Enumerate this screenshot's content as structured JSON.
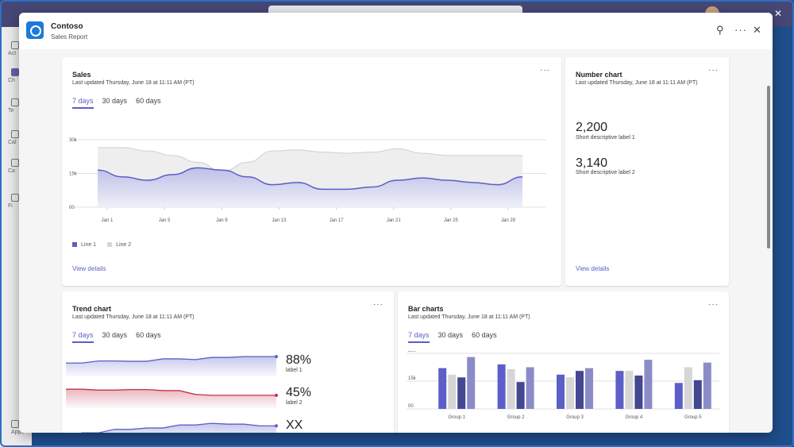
{
  "app": {
    "name": "Contoso",
    "subtitle": "Sales Report"
  },
  "rail": {
    "items": [
      "Act",
      "Ch",
      "Te",
      "Cal",
      "Ca",
      "Fi",
      "Apps"
    ]
  },
  "sales": {
    "title": "Sales",
    "updated": "Last updated Thursday, June 18 at 11:11 AM (PT)",
    "tabs": [
      "7 days",
      "30 days",
      "60 days"
    ],
    "link": "View details"
  },
  "number_chart": {
    "title": "Number chart",
    "updated": "Last updated Thursday, June 18 at 11:11 AM (PT)",
    "value1": "2,200",
    "label1": "Short descriptive label 1",
    "value2": "3,140",
    "label2": "Short descriptive label 2",
    "link": "View details"
  },
  "trend": {
    "title": "Trend chart",
    "updated": "Last updated Thursday, June 18 at 11:11 AM (PT)",
    "tabs": [
      "7 days",
      "30 days",
      "60 days"
    ],
    "items": [
      {
        "pct": "88%",
        "label": "label 1",
        "color": "#5b5fc7"
      },
      {
        "pct": "45%",
        "label": "label 2",
        "color": "#c4314b"
      },
      {
        "pct": "XX",
        "label": "",
        "color": "#5b5fc7"
      }
    ],
    "series": [
      [
        0.42,
        0.42,
        0.3,
        0.3,
        0.32,
        0.32,
        0.18,
        0.18,
        0.22,
        0.1,
        0.1,
        0.05,
        0.05,
        0.05
      ],
      [
        0.1,
        0.1,
        0.15,
        0.15,
        0.12,
        0.12,
        0.18,
        0.18,
        0.4,
        0.45,
        0.45,
        0.45,
        0.45,
        0.45
      ],
      [
        0.95,
        0.6,
        0.6,
        0.4,
        0.4,
        0.32,
        0.32,
        0.15,
        0.15,
        0.05,
        0.1,
        0.1,
        0.2,
        0.2
      ]
    ]
  },
  "bar": {
    "title": "Bar charts",
    "updated": "Last updated Thursday, June 18 at 11:11 AM (PT)",
    "tabs": [
      "7 days",
      "30 days",
      "60 days"
    ]
  },
  "chart_data": [
    {
      "type": "area",
      "title": "Sales",
      "x": [
        "Jan 1",
        "Jan 5",
        "Jan 9",
        "Jan 13",
        "Jan 17",
        "Jan 21",
        "Jan 25",
        "Jan 29"
      ],
      "ytick_labels": [
        "00",
        "15k",
        "30k"
      ],
      "ylim": [
        0,
        30000
      ],
      "series": [
        {
          "name": "Line 1",
          "color": "#5b5fc7",
          "values": [
            16500,
            13500,
            12000,
            14500,
            17500,
            16500,
            13500,
            10000,
            11000,
            8000,
            8000,
            9000,
            12000,
            13000,
            12000,
            11000,
            10000,
            13500
          ]
        },
        {
          "name": "Line 2",
          "color": "#c8c8c8",
          "values": [
            26500,
            26500,
            25000,
            23000,
            20000,
            16000,
            20000,
            25000,
            25500,
            24500,
            24000,
            24500,
            26000,
            24000,
            23000,
            23000,
            23000,
            23000
          ]
        }
      ],
      "legend": "bottom-left",
      "grid": true
    },
    {
      "type": "bar",
      "title": "Bar charts",
      "categories": [
        "Group 1",
        "Group 2",
        "Group 3",
        "Group 4",
        "Group 5"
      ],
      "ytick_labels": [
        "00",
        "15k",
        "30k"
      ],
      "ylim": [
        0,
        30000
      ],
      "series": [
        {
          "color": "#5b5fc7",
          "values": [
            22000,
            24000,
            18500,
            20500,
            14000
          ]
        },
        {
          "color": "#d6d6d6",
          "values": [
            18500,
            21500,
            17000,
            20500,
            22500
          ]
        },
        {
          "color": "#444791",
          "values": [
            17000,
            14500,
            20500,
            18000,
            15500
          ]
        },
        {
          "color": "#8b8cc7",
          "values": [
            28000,
            22500,
            22000,
            26500,
            25000
          ]
        }
      ],
      "grid": true
    }
  ]
}
